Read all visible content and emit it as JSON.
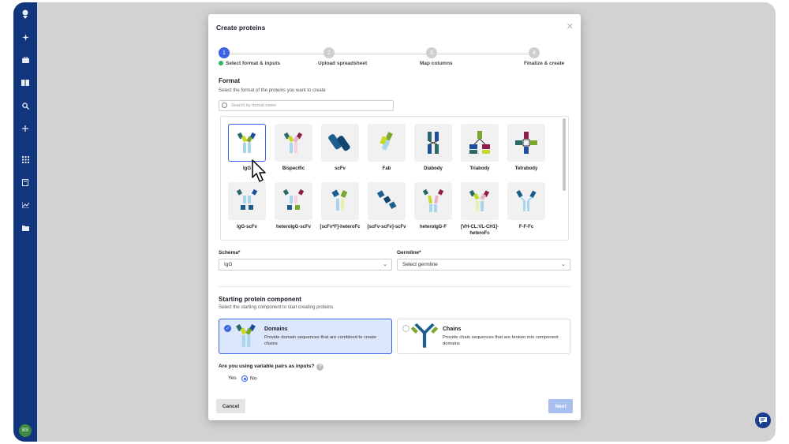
{
  "modal": {
    "title": "Create proteins",
    "close_icon": "close-icon"
  },
  "stepper": {
    "steps": [
      {
        "number": "1",
        "label": "Select format & inputs"
      },
      {
        "number": "2",
        "label": "Upload spreadsheet"
      },
      {
        "number": "3",
        "label": "Map columns"
      },
      {
        "number": "4",
        "label": "Finalize & create"
      }
    ]
  },
  "format": {
    "title": "Format",
    "subtitle": "Select the format of the proteins you want to create",
    "search_placeholder": "Search by format name",
    "row1": [
      "IgG",
      "Bispecific",
      "scFv",
      "Fab",
      "Diabody",
      "Triabody",
      "Tetrabody"
    ],
    "row2": [
      "IgG-scFv",
      "heteroIgG-scFv",
      "[scFv*F]-heteroFc",
      "[scFv-scFv]-scFv",
      "heteroIgG-F",
      "[VH-CL:VL-CH1]-heteroFc",
      "F-F-Fc"
    ],
    "selected": "IgG"
  },
  "schema": {
    "label": "Schema*",
    "value": "IgG"
  },
  "germline": {
    "label": "Germline*",
    "value": "Select germline"
  },
  "starting": {
    "title": "Starting protein component",
    "subtitle": "Select the starting component to start creating proteins",
    "domains_title": "Domains",
    "domains_desc": "Provide domain sequences that are combined to create chains",
    "chains_title": "Chains",
    "chains_desc": "Provide chain sequences that are broken into component domains"
  },
  "variable_pairs": {
    "question": "Are you using variable pairs as inputs?",
    "help": "?",
    "yes": "Yes",
    "no": "No",
    "selected": "No"
  },
  "footer": {
    "cancel": "Cancel",
    "next": "Next"
  },
  "sidebar": {
    "icons": [
      "logo-icon",
      "sparkle-icon",
      "briefcase-icon",
      "book-icon",
      "search-icon",
      "plus-icon",
      "grid-icon",
      "document-icon",
      "chart-icon",
      "folder-icon"
    ],
    "avatar_initials": "BS"
  },
  "colors": {
    "primary": "#3b63e3",
    "rail": "#11367e",
    "selected_bg": "#dde7fb",
    "next_disabled": "#a9bff0"
  }
}
